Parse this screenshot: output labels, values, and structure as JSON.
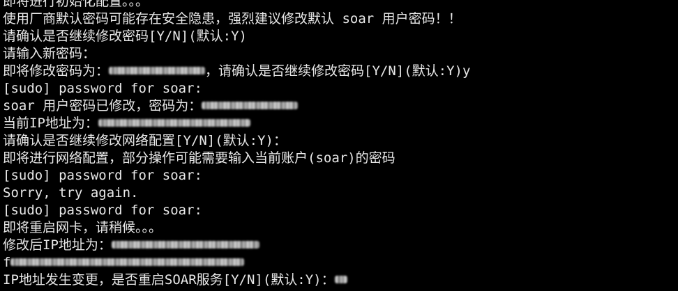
{
  "terminal": {
    "lines": {
      "l00": "即将进行初始化配置。。。",
      "l01": "使用厂商默认密码可能存在安全隐患，强烈建议修改默认 soar 用户密码！！",
      "l02": "请确认是否继续修改密码[Y/N](默认:Y)",
      "l03": "请输入新密码：",
      "l04a": "即将修改密码为：",
      "l04b": "，请确认是否继续修改密码[Y/N](默认:Y)y",
      "l05": "[sudo] password for soar:",
      "l06": "soar 用户密码已修改，密码为：",
      "l07": "当前IP地址为：",
      "l08": "请确认是否继续修改网络配置[Y/N](默认:Y)：",
      "l09": "即将进行网络配置，部分操作可能需要输入当前账户(soar)的密码",
      "l10": "[sudo] password for soar:",
      "l11": "Sorry, try again.",
      "l12": "[sudo] password for soar:",
      "l13": "即将重启网卡，请稍候。。。",
      "l14": "修改后IP地址为：",
      "l15": "f",
      "l16": "IP地址发生变更，是否重启SOAR服务[Y/N](默认:Y)："
    }
  }
}
